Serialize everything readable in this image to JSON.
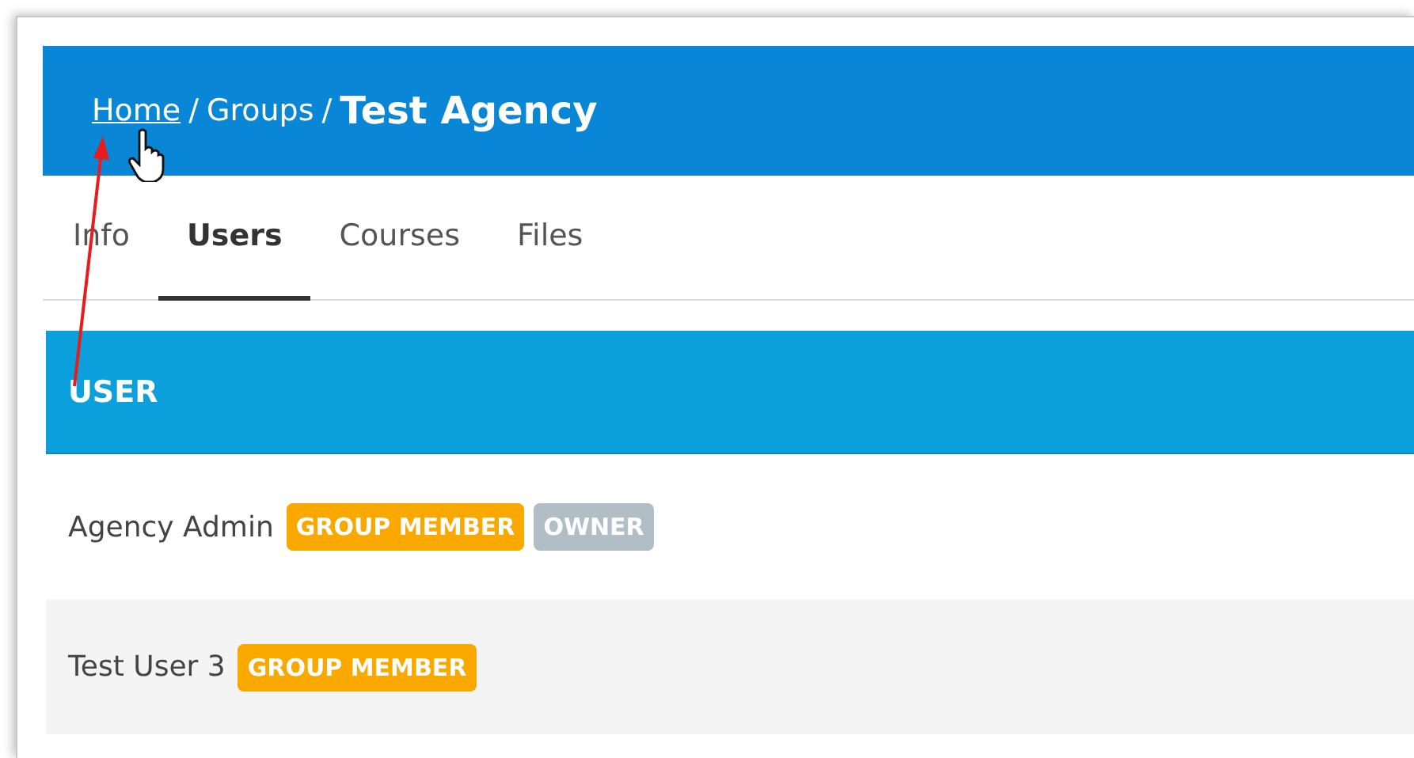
{
  "breadcrumb": {
    "links": [
      {
        "label": "Home",
        "underlined": true
      },
      {
        "label": "Groups",
        "underlined": false
      }
    ],
    "separator": "/",
    "current": "Test Agency"
  },
  "tabs": [
    {
      "label": "Info",
      "selected": false
    },
    {
      "label": "Users",
      "selected": true
    },
    {
      "label": "Courses",
      "selected": false
    },
    {
      "label": "Files",
      "selected": false
    }
  ],
  "table": {
    "columns": [
      "USER"
    ],
    "rows": [
      {
        "name": "Agency Admin",
        "badges": [
          {
            "label": "GROUP MEMBER",
            "color": "#f9a800"
          },
          {
            "label": "OWNER",
            "color": "#b2bec5"
          }
        ]
      },
      {
        "name": "Test User 3",
        "badges": [
          {
            "label": "GROUP MEMBER",
            "color": "#f9a800"
          }
        ]
      }
    ]
  }
}
